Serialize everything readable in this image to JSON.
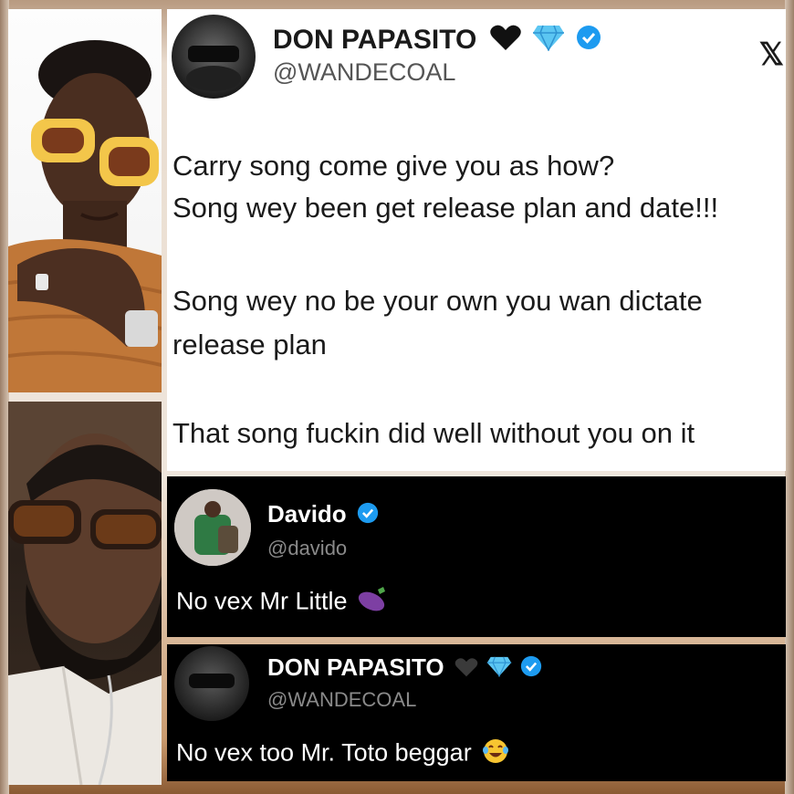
{
  "tweet_main": {
    "name": "DON PAPASITO",
    "handle": "@WANDECOAL",
    "platform_logo": "x-logo",
    "lines": [
      "Carry song come give you as how?",
      "Song wey been get release plan and date!!!",
      "Song wey no be your own you wan dictate",
      "release plan",
      "That song fuckin did well without you on it"
    ],
    "badges": [
      "black-heart-icon",
      "gem-icon",
      "verified-icon"
    ]
  },
  "reply_1": {
    "name": "Davido",
    "handle": "@davido",
    "text": "No vex Mr Little",
    "emoji": "eggplant-icon",
    "badges": [
      "verified-icon"
    ]
  },
  "reply_2": {
    "name": "DON PAPASITO",
    "handle": "@WANDECOAL",
    "text": "No vex too Mr. Toto beggar",
    "emoji": "laughing-tears-icon",
    "badges": [
      "black-heart-icon",
      "gem-icon",
      "verified-icon"
    ]
  },
  "colors": {
    "verified": "#1d9bf0",
    "dark_bg": "#000000",
    "light_bg": "#ffffff",
    "handle_gray_light": "#555555",
    "handle_gray_dark": "#8a8a8a"
  }
}
